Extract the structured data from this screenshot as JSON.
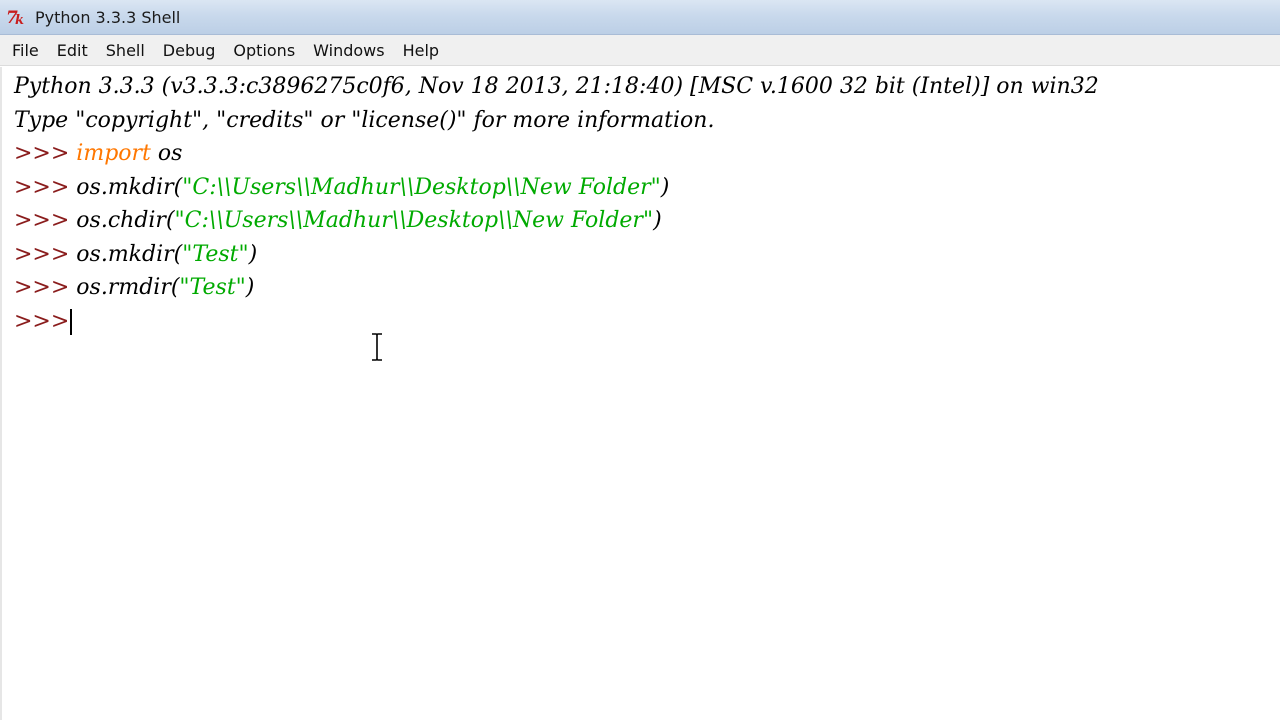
{
  "window": {
    "title": "Python 3.3.3 Shell",
    "icon": "tk-feather-icon"
  },
  "menu": {
    "items": [
      "File",
      "Edit",
      "Shell",
      "Debug",
      "Options",
      "Windows",
      "Help"
    ]
  },
  "shell": {
    "banner_line1": "Python 3.3.3 (v3.3.3:c3896275c0f6, Nov 18 2013, 21:18:40) [MSC v.1600 32 bit (Intel)] on win32",
    "banner_line2": "Type \"copyright\", \"credits\" or \"license()\" for more information.",
    "prompt": ">>> ",
    "lines": [
      {
        "kw": "import",
        "code": " os",
        "str": "",
        "tail": ""
      },
      {
        "kw": "",
        "code": "os.mkdir(",
        "str": "\"C:\\\\Users\\\\Madhur\\\\Desktop\\\\New Folder\"",
        "tail": ")"
      },
      {
        "kw": "",
        "code": "os.chdir(",
        "str": "\"C:\\\\Users\\\\Madhur\\\\Desktop\\\\New Folder\"",
        "tail": ")"
      },
      {
        "kw": "",
        "code": "os.mkdir(",
        "str": "\"Test\"",
        "tail": ")"
      },
      {
        "kw": "",
        "code": "os.rmdir(",
        "str": "\"Test\"",
        "tail": ")"
      }
    ],
    "current_prompt": ">>>"
  },
  "colors": {
    "prompt": "#8a1c1c",
    "keyword": "#ff7700",
    "string": "#00aa00",
    "titlebar": "#c9d9ec"
  }
}
